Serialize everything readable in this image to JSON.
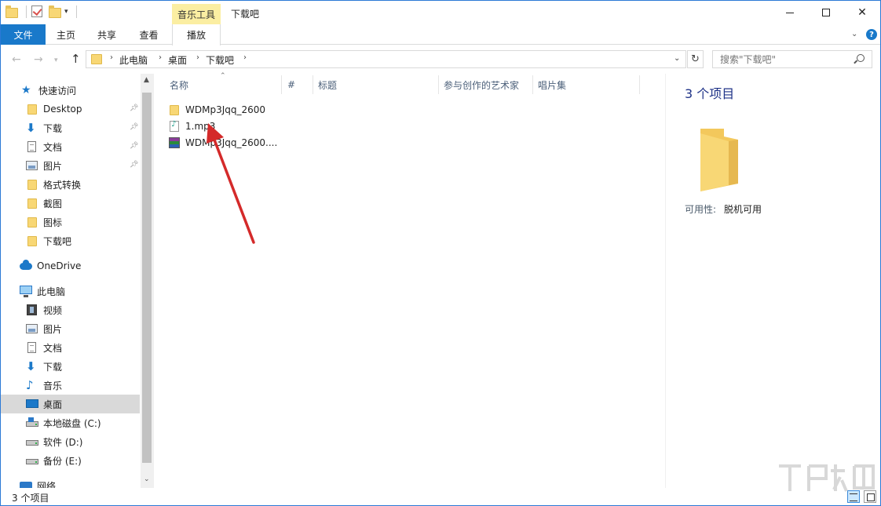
{
  "window": {
    "title": "下载吧",
    "contextual_tab_group": "音乐工具"
  },
  "ribbon": {
    "tabs": [
      {
        "label": "文件"
      },
      {
        "label": "主页"
      },
      {
        "label": "共享"
      },
      {
        "label": "查看"
      },
      {
        "label": "播放"
      }
    ],
    "help": "?"
  },
  "address": {
    "crumbs": [
      "此电脑",
      "桌面",
      "下载吧"
    ]
  },
  "search": {
    "placeholder": "搜索\"下载吧\""
  },
  "sidebar": {
    "quick_access": "快速访问",
    "quick_items": [
      {
        "label": "Desktop",
        "icon": "folder-icon"
      },
      {
        "label": "下载",
        "icon": "download-arrow-icon"
      },
      {
        "label": "文档",
        "icon": "document-icon"
      },
      {
        "label": "图片",
        "icon": "pictures-icon"
      },
      {
        "label": "格式转换",
        "icon": "folder-icon"
      },
      {
        "label": "截图",
        "icon": "folder-icon"
      },
      {
        "label": "图标",
        "icon": "folder-icon"
      },
      {
        "label": "下载吧",
        "icon": "folder-icon"
      }
    ],
    "onedrive": "OneDrive",
    "this_pc": "此电脑",
    "pc_items": [
      {
        "label": "视频",
        "icon": "video-icon"
      },
      {
        "label": "图片",
        "icon": "pictures-icon"
      },
      {
        "label": "文档",
        "icon": "document-icon"
      },
      {
        "label": "下载",
        "icon": "download-arrow-icon"
      },
      {
        "label": "音乐",
        "icon": "music-icon"
      },
      {
        "label": "桌面",
        "icon": "desktop-icon"
      },
      {
        "label": "本地磁盘 (C:)",
        "icon": "drive-c-icon"
      },
      {
        "label": "软件 (D:)",
        "icon": "drive-icon"
      },
      {
        "label": "备份 (E:)",
        "icon": "drive-icon"
      }
    ],
    "network": "网络"
  },
  "columns": [
    "名称",
    "#",
    "标题",
    "参与创作的艺术家",
    "唱片集"
  ],
  "files": [
    {
      "name": "WDMp3Jqq_2600",
      "icon": "folder-icon"
    },
    {
      "name": "1.mp3",
      "icon": "mp3-file-icon"
    },
    {
      "name": "WDMp3Jqq_2600....",
      "icon": "archive-icon"
    }
  ],
  "details": {
    "count": "3 个项目",
    "availability_label": "可用性:",
    "availability_value": "脱机可用"
  },
  "status": {
    "text": "3 个项目"
  },
  "colors": {
    "accent": "#1979ca",
    "contextual": "#fbeea2",
    "selection": "#d9d9d9",
    "annotation": "#d42a2a"
  }
}
